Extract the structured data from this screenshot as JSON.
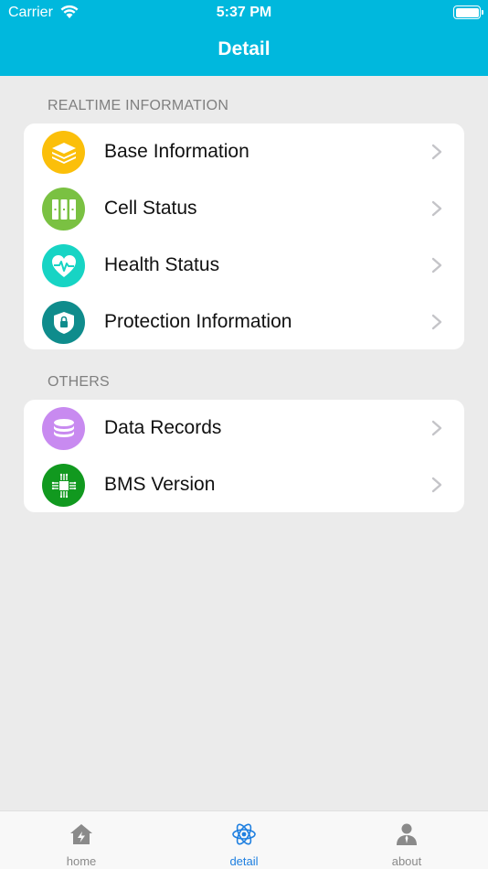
{
  "status_bar": {
    "carrier": "Carrier",
    "time": "5:37 PM"
  },
  "nav": {
    "title": "Detail"
  },
  "sections": [
    {
      "header": "REALTIME INFORMATION",
      "items": [
        {
          "label": "Base Information",
          "icon": "layers-icon",
          "color": "#fbbf0a"
        },
        {
          "label": "Cell Status",
          "icon": "cells-icon",
          "color": "#7ac142"
        },
        {
          "label": "Health Status",
          "icon": "heart-pulse-icon",
          "color": "#17d4c4"
        },
        {
          "label": "Protection Information",
          "icon": "shield-lock-icon",
          "color": "#0f8c8c"
        }
      ]
    },
    {
      "header": "OTHERS",
      "items": [
        {
          "label": "Data Records",
          "icon": "database-icon",
          "color": "#c88af0"
        },
        {
          "label": "BMS Version",
          "icon": "chip-icon",
          "color": "#11991f"
        }
      ]
    }
  ],
  "tabs": [
    {
      "label": "home",
      "icon": "home-bolt-icon",
      "active": false
    },
    {
      "label": "detail",
      "icon": "atom-icon",
      "active": true
    },
    {
      "label": "about",
      "icon": "person-icon",
      "active": false
    }
  ],
  "colors": {
    "header": "#00b8dd",
    "active_tab": "#1e7fe0",
    "inactive_tab": "#8a8a8a",
    "background": "#ebebeb"
  }
}
